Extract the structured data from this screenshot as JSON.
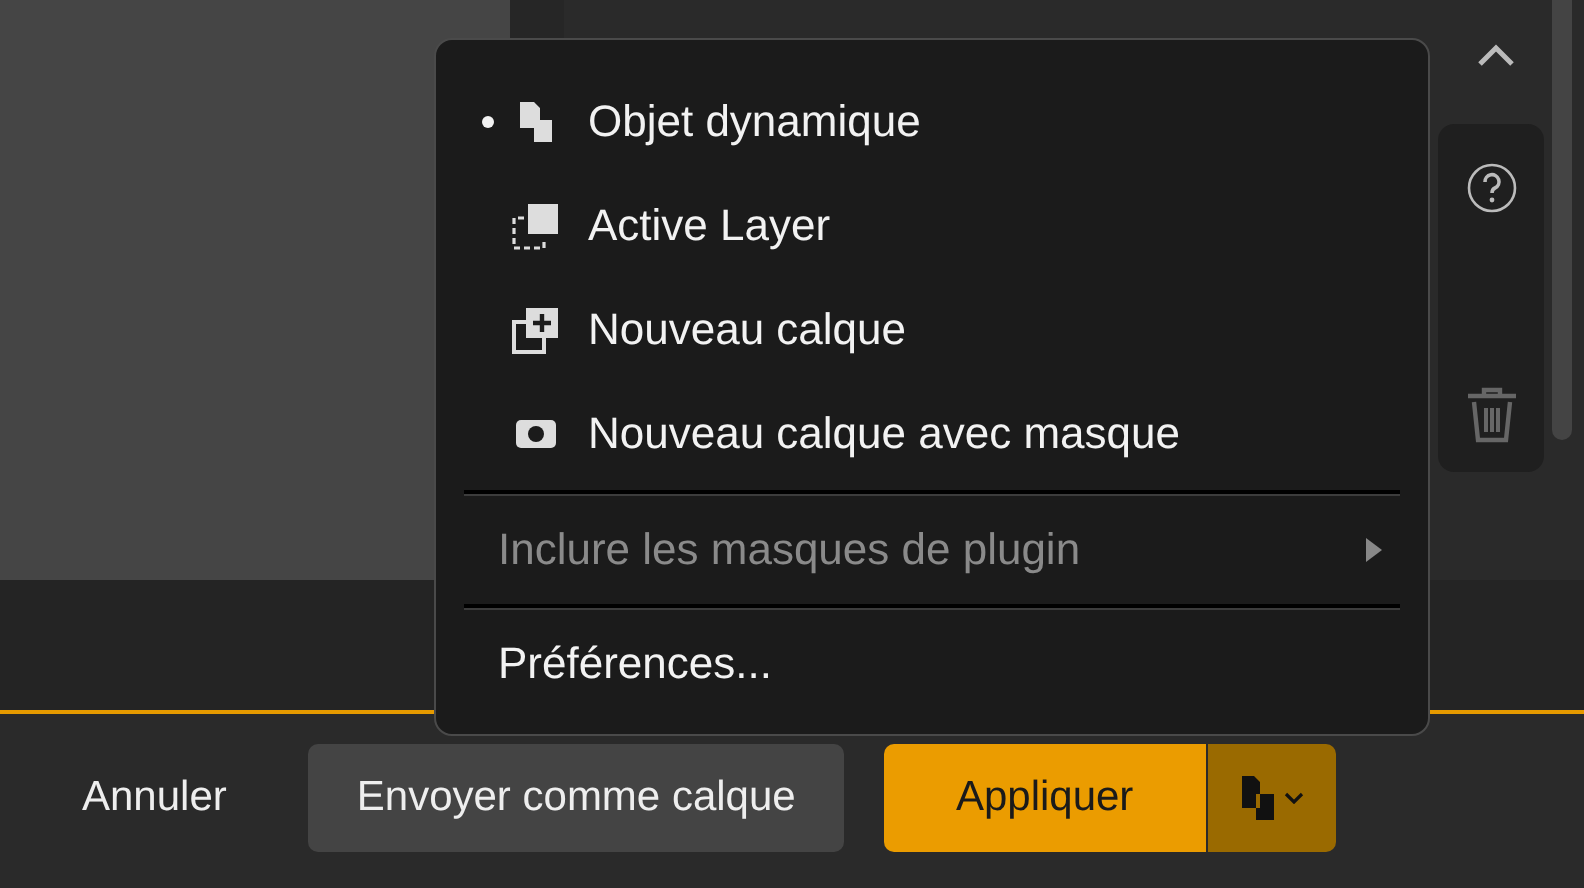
{
  "menu": {
    "items": [
      {
        "kind": "option",
        "label": "Objet dynamique",
        "selected": true
      },
      {
        "kind": "option",
        "label": "Active Layer",
        "selected": false
      },
      {
        "kind": "option",
        "label": "Nouveau calque",
        "selected": false
      },
      {
        "kind": "option",
        "label": "Nouveau calque avec masque",
        "selected": false
      },
      {
        "kind": "separator"
      },
      {
        "kind": "submenu",
        "label": "Inclure les masques de plugin",
        "disabled": true
      },
      {
        "kind": "separator"
      },
      {
        "kind": "action",
        "label": "Préférences...",
        "disabled": false
      }
    ]
  },
  "footer": {
    "cancel": "Annuler",
    "send": "Envoyer comme calque",
    "apply": "Appliquer"
  }
}
